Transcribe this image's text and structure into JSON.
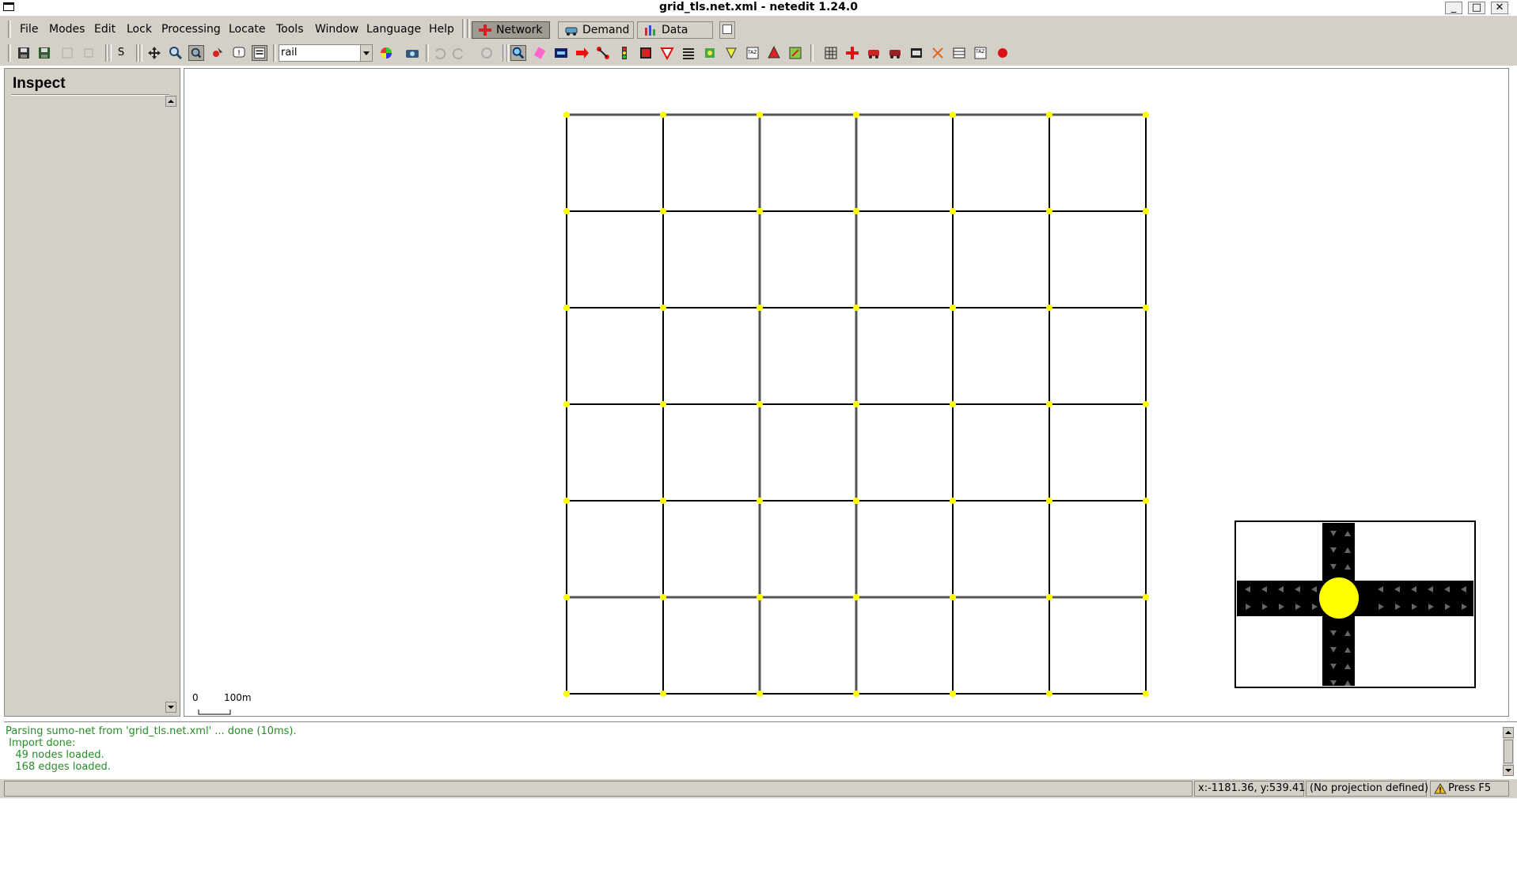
{
  "window": {
    "title": "grid_tls.net.xml - netedit 1.24.0",
    "minimize": "_",
    "maximize": "□",
    "close": "✕"
  },
  "menu": [
    "File",
    "Modes",
    "Edit",
    "Lock",
    "Processing",
    "Locate",
    "Tools",
    "Window",
    "Language",
    "Help"
  ],
  "supermodes": {
    "network": "Network",
    "demand": "Demand",
    "data": "Data"
  },
  "toolbar": {
    "s_label": "S",
    "vclass_combo": "rail"
  },
  "inspect": {
    "title": "Inspect"
  },
  "scale": {
    "zero": "0",
    "length": "100m"
  },
  "log": [
    "Parsing sumo-net from 'grid_tls.net.xml' ... done (10ms).",
    " Import done:",
    "   49 nodes loaded.",
    "   168 edges loaded."
  ],
  "status": {
    "coords": "x:-1181.36, y:539.41",
    "projection": "(No projection defined)",
    "hint": "Press F5"
  },
  "colors": {
    "junction": "#ffff00",
    "edge": "#000000",
    "panel": "#d4d0c8",
    "log_text": "#2a8a2a"
  },
  "icons": [
    "save-icon",
    "save-as-icon",
    "reload-icon",
    "select-icon",
    "move-icon",
    "zoom-icon",
    "inspect-icon",
    "delete-icon",
    "camera-icon",
    "undo-icon",
    "redo-icon",
    "network-icon",
    "demand-icon",
    "data-icon"
  ]
}
